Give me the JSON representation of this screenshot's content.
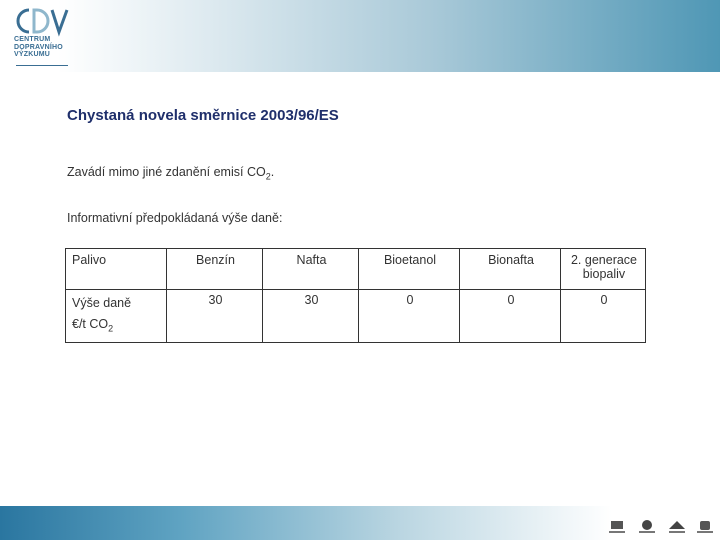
{
  "logo": {
    "lines": [
      "CENTRUM",
      "DOPRAVNÍHO",
      "VÝZKUMU"
    ]
  },
  "title": "Chystaná novela směrnice 2003/96/ES",
  "intro": {
    "text": "Zavádí mimo jiné zdanění emisí CO",
    "sub": "2",
    "end": "."
  },
  "info": "Informativní předpokládaná výše daně:",
  "table": {
    "header": [
      "Palivo",
      "Benzín",
      "Nafta",
      "Bioetanol",
      "Bionafta",
      "2. generace biopaliv"
    ],
    "row_label_line1": "Výše daně",
    "row_label_line2": "€/t CO",
    "row_label_sub": "2",
    "values": [
      "30",
      "30",
      "0",
      "0",
      "0"
    ]
  },
  "colors": {
    "title": "#1f2f6b",
    "header_accent": "#4f97b5",
    "footer_accent": "#2a76a0"
  }
}
